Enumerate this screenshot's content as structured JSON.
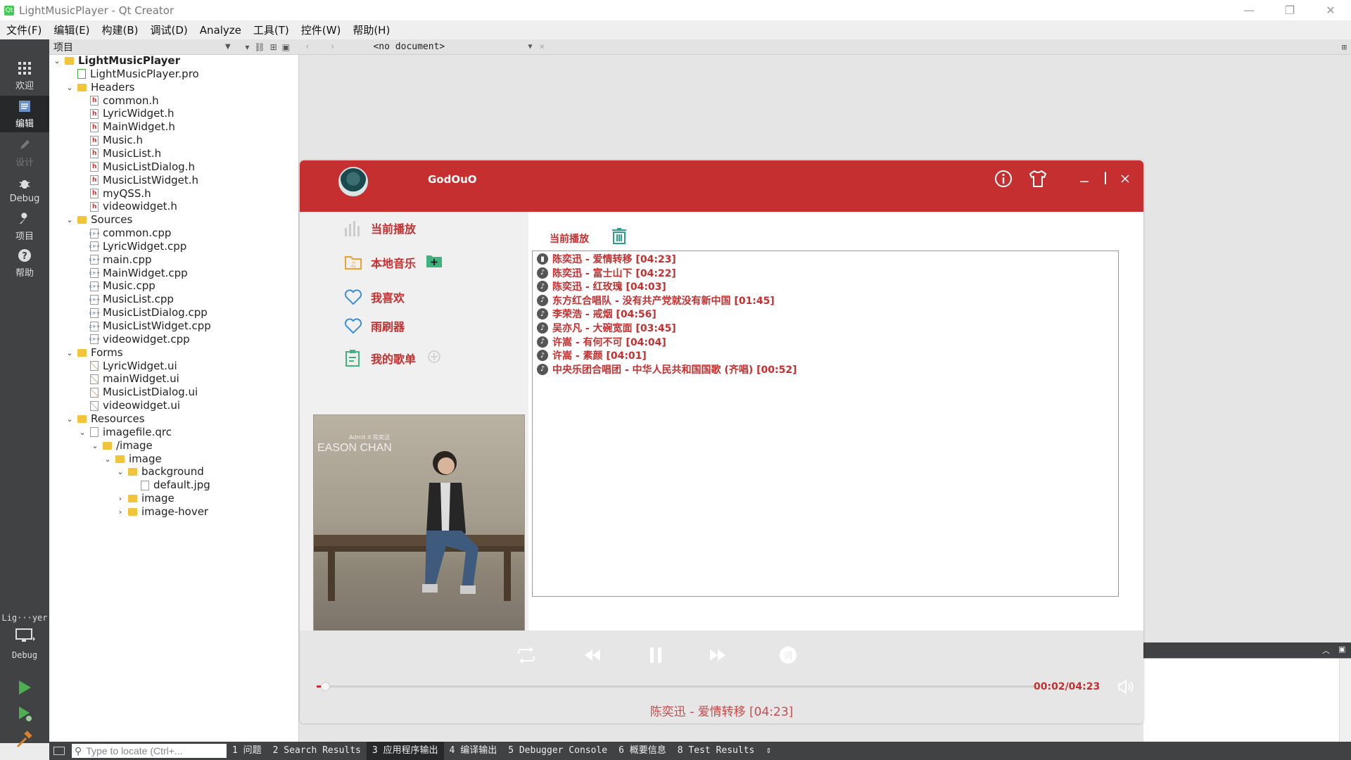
{
  "window": {
    "title": "LightMusicPlayer - Qt Creator",
    "controls": [
      "—",
      "❐",
      "✕"
    ]
  },
  "menu": [
    "文件(F)",
    "编辑(E)",
    "构建(B)",
    "调试(D)",
    "Analyze",
    "工具(T)",
    "控件(W)",
    "帮助(H)"
  ],
  "modes": {
    "welcome": "欢迎",
    "edit": "编辑",
    "design": "设计",
    "debug": "Debug",
    "projects": "项目",
    "help": "帮助"
  },
  "kit": {
    "project": "Lig···yer",
    "config": "Debug"
  },
  "project_pane": {
    "title": "项目"
  },
  "editor_toolbar": {
    "document": "<no document>"
  },
  "tree": [
    {
      "label": "LightMusicPlayer",
      "depth": 0,
      "kind": "project",
      "arrow": "v",
      "bold": true
    },
    {
      "label": "LightMusicPlayer.pro",
      "depth": 1,
      "kind": "pro",
      "arrow": ""
    },
    {
      "label": "Headers",
      "depth": 1,
      "kind": "folder",
      "arrow": "v"
    },
    {
      "label": "common.h",
      "depth": 2,
      "kind": "h",
      "arrow": ""
    },
    {
      "label": "LyricWidget.h",
      "depth": 2,
      "kind": "h",
      "arrow": ""
    },
    {
      "label": "MainWidget.h",
      "depth": 2,
      "kind": "h",
      "arrow": ""
    },
    {
      "label": "Music.h",
      "depth": 2,
      "kind": "h",
      "arrow": ""
    },
    {
      "label": "MusicList.h",
      "depth": 2,
      "kind": "h",
      "arrow": ""
    },
    {
      "label": "MusicListDialog.h",
      "depth": 2,
      "kind": "h",
      "arrow": ""
    },
    {
      "label": "MusicListWidget.h",
      "depth": 2,
      "kind": "h",
      "arrow": ""
    },
    {
      "label": "myQSS.h",
      "depth": 2,
      "kind": "h",
      "arrow": ""
    },
    {
      "label": "videowidget.h",
      "depth": 2,
      "kind": "h",
      "arrow": ""
    },
    {
      "label": "Sources",
      "depth": 1,
      "kind": "folder",
      "arrow": "v"
    },
    {
      "label": "common.cpp",
      "depth": 2,
      "kind": "cpp",
      "arrow": ""
    },
    {
      "label": "LyricWidget.cpp",
      "depth": 2,
      "kind": "cpp",
      "arrow": ""
    },
    {
      "label": "main.cpp",
      "depth": 2,
      "kind": "cpp",
      "arrow": ""
    },
    {
      "label": "MainWidget.cpp",
      "depth": 2,
      "kind": "cpp",
      "arrow": ""
    },
    {
      "label": "Music.cpp",
      "depth": 2,
      "kind": "cpp",
      "arrow": ""
    },
    {
      "label": "MusicList.cpp",
      "depth": 2,
      "kind": "cpp",
      "arrow": ""
    },
    {
      "label": "MusicListDialog.cpp",
      "depth": 2,
      "kind": "cpp",
      "arrow": ""
    },
    {
      "label": "MusicListWidget.cpp",
      "depth": 2,
      "kind": "cpp",
      "arrow": ""
    },
    {
      "label": "videowidget.cpp",
      "depth": 2,
      "kind": "cpp",
      "arrow": ""
    },
    {
      "label": "Forms",
      "depth": 1,
      "kind": "folder",
      "arrow": "v"
    },
    {
      "label": "LyricWidget.ui",
      "depth": 2,
      "kind": "ui",
      "arrow": ""
    },
    {
      "label": "mainWidget.ui",
      "depth": 2,
      "kind": "ui",
      "arrow": ""
    },
    {
      "label": "MusicListDialog.ui",
      "depth": 2,
      "kind": "ui",
      "arrow": ""
    },
    {
      "label": "videowidget.ui",
      "depth": 2,
      "kind": "ui",
      "arrow": ""
    },
    {
      "label": "Resources",
      "depth": 1,
      "kind": "folder",
      "arrow": "v"
    },
    {
      "label": "imagefile.qrc",
      "depth": 2,
      "kind": "qrc",
      "arrow": "v"
    },
    {
      "label": "/image",
      "depth": 3,
      "kind": "folder",
      "arrow": "v"
    },
    {
      "label": "image",
      "depth": 4,
      "kind": "folder",
      "arrow": "v"
    },
    {
      "label": "background",
      "depth": 5,
      "kind": "folder",
      "arrow": "v"
    },
    {
      "label": "default.jpg",
      "depth": 6,
      "kind": "img",
      "arrow": ""
    },
    {
      "label": "image",
      "depth": 5,
      "kind": "folder",
      "arrow": ">"
    },
    {
      "label": "image-hover",
      "depth": 5,
      "kind": "folder",
      "arrow": ">"
    }
  ],
  "statusbar": {
    "locate_placeholder": "Type to locate (Ctrl+...",
    "tabs": [
      "1 问题",
      "2 Search Results",
      "3 应用程序输出",
      "4 编译输出",
      "5 Debugger Console",
      "6 概要信息",
      "8 Test Results"
    ],
    "active_tab": 2
  },
  "player": {
    "username": "GodOuO",
    "sidebar": {
      "now_playing": "当前播放",
      "local_music": "本地音乐",
      "favorites": "我喜欢",
      "playlist_item": "雨刷器",
      "my_playlists": "我的歌单"
    },
    "album_art_text": "EASON CHAN",
    "album_art_sub": "Admit it 陈奕迅",
    "list_title": "当前播放",
    "songs": [
      "陈奕迅 - 爱情转移 [04:23]",
      "陈奕迅 - 富士山下 [04:22]",
      "陈奕迅 - 红玫瑰 [04:03]",
      "东方红合唱队 - 没有共产党就没有新中国 [01:45]",
      "李荣浩 - 戒烟 [04:56]",
      "吴亦凡 - 大碗宽面 [03:45]",
      "许嵩 - 有何不可 [04:04]",
      "许嵩 - 素颜 [04:01]",
      "中央乐团合唱团 - 中华人民共和国国歌 (齐唱) [00:52]"
    ],
    "playing_index": 0,
    "time": "00:02/04:23",
    "progress": 0.0076,
    "now_playing_text": "陈奕迅 - 爱情转移 [04:23]",
    "colors": {
      "accent": "#c62f2f"
    }
  }
}
